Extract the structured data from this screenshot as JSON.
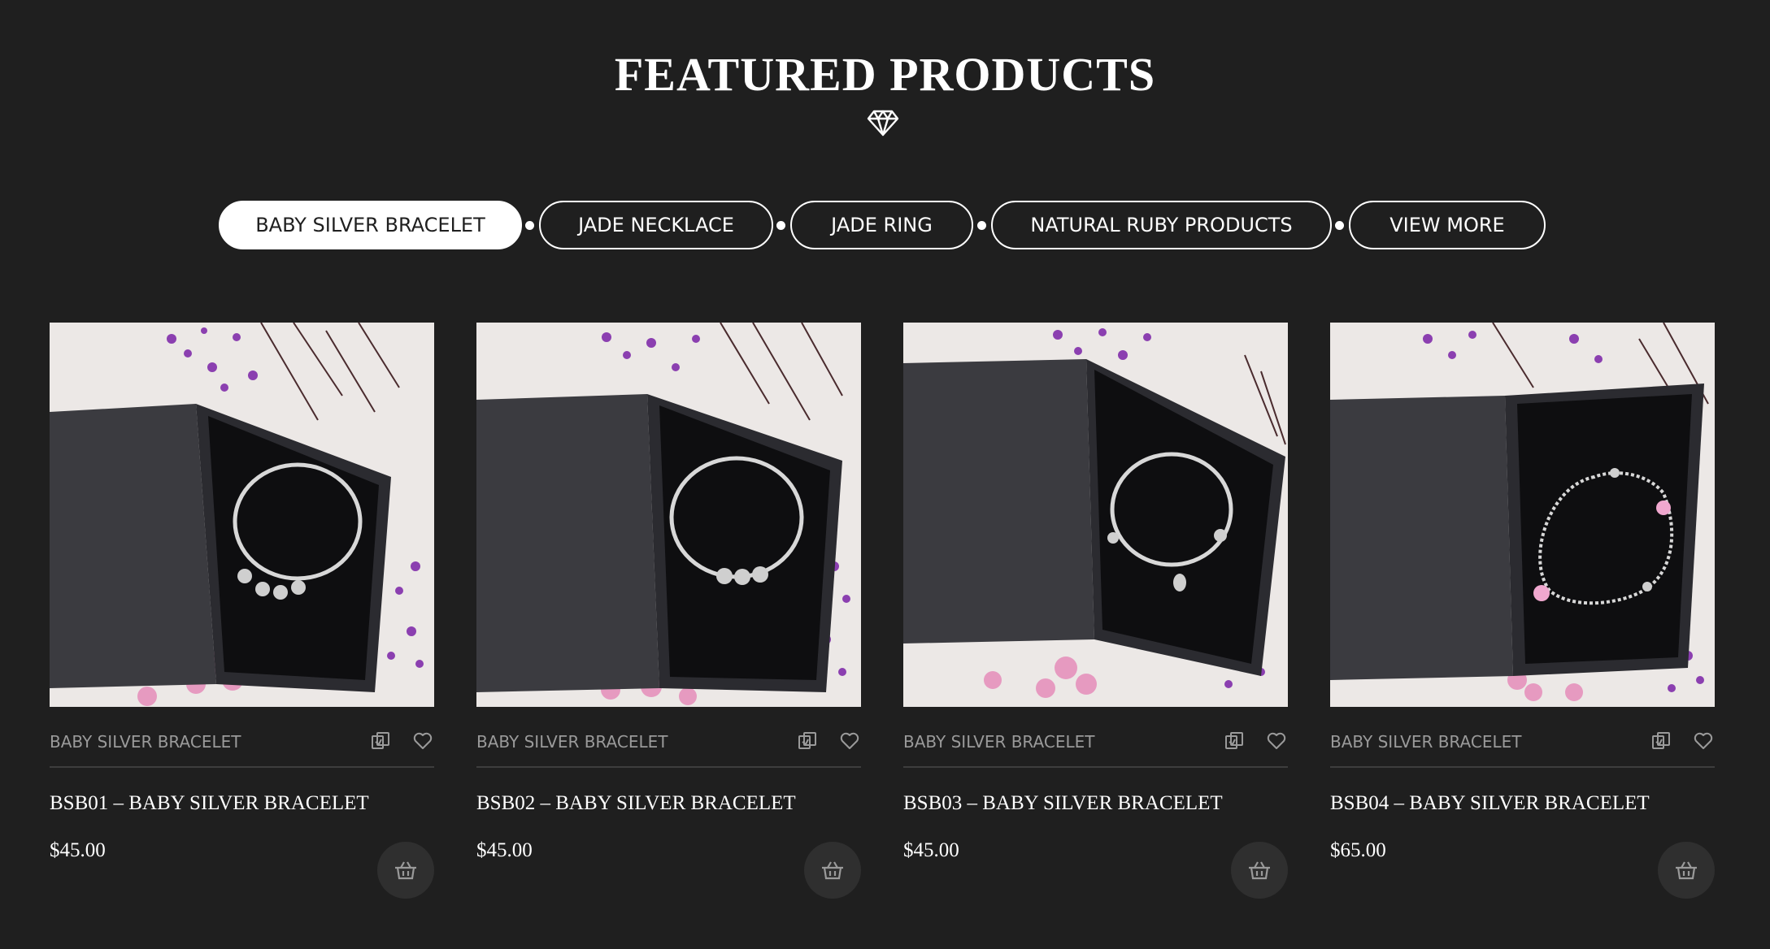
{
  "section": {
    "title": "FEATURED PRODUCTS",
    "icon": "diamond-icon"
  },
  "tabs": [
    {
      "label": "BABY SILVER BRACELET",
      "active": true
    },
    {
      "label": "JADE NECKLACE",
      "active": false
    },
    {
      "label": "JADE RING",
      "active": false
    },
    {
      "label": "NATURAL RUBY PRODUCTS",
      "active": false
    },
    {
      "label": "VIEW MORE",
      "active": false
    }
  ],
  "products": [
    {
      "category": "BABY SILVER BRACELET",
      "name": "BSB01 – BABY SILVER BRACELET",
      "price": "$45.00",
      "image": "bangle-with-bells-in-black-box"
    },
    {
      "category": "BABY SILVER BRACELET",
      "name": "BSB02 – BABY SILVER BRACELET",
      "price": "$45.00",
      "image": "bangle-with-beads-in-black-box"
    },
    {
      "category": "BABY SILVER BRACELET",
      "name": "BSB03 – BABY SILVER BRACELET",
      "price": "$45.00",
      "image": "bangle-with-bear-charm-in-black-box"
    },
    {
      "category": "BABY SILVER BRACELET",
      "name": "BSB04 – BABY SILVER BRACELET",
      "price": "$65.00",
      "image": "chain-bracelet-with-pink-charms-in-black-box"
    }
  ],
  "icons": {
    "compare": "compare-icon",
    "wishlist": "heart-icon",
    "cart": "basket-icon"
  },
  "colors": {
    "background": "#1f1f1f",
    "text": "#ffffff",
    "muted": "#9a9a9a",
    "divider": "#3d3d3d",
    "cart_button": "#2f2f2f"
  }
}
